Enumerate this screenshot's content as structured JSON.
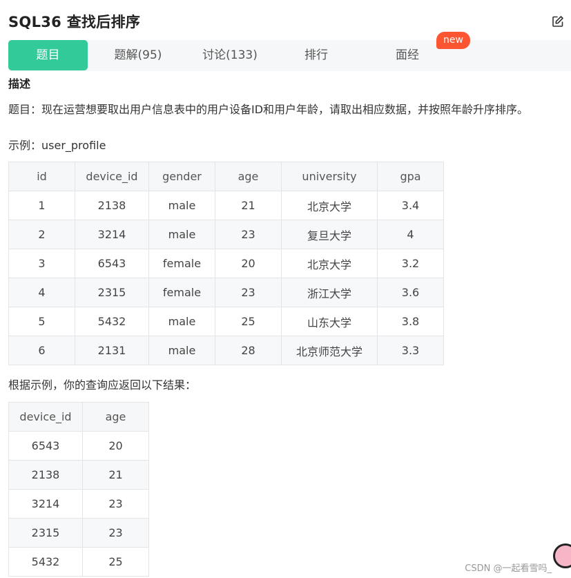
{
  "header": {
    "title": "SQL36  查找后排序"
  },
  "tabs": [
    {
      "label": "题目",
      "active": true
    },
    {
      "label": "题解(95)",
      "active": false
    },
    {
      "label": "讨论(133)",
      "active": false
    },
    {
      "label": "排行",
      "active": false
    },
    {
      "label": "面经",
      "active": false
    }
  ],
  "badge": {
    "label": "new"
  },
  "description": {
    "heading": "描述",
    "text": "题目：现在运营想要取出用户信息表中的用户设备ID和用户年龄，请取出相应数据，并按照年龄升序排序。"
  },
  "example": {
    "label": "示例：user_profile",
    "columns": [
      "id",
      "device_id",
      "gender",
      "age",
      "university",
      "gpa"
    ],
    "rows": [
      [
        "1",
        "2138",
        "male",
        "21",
        "北京大学",
        "3.4"
      ],
      [
        "2",
        "3214",
        "male",
        "23",
        "复旦大学",
        "4"
      ],
      [
        "3",
        "6543",
        "female",
        "20",
        "北京大学",
        "3.2"
      ],
      [
        "4",
        "2315",
        "female",
        "23",
        "浙江大学",
        "3.6"
      ],
      [
        "5",
        "5432",
        "male",
        "25",
        "山东大学",
        "3.8"
      ],
      [
        "6",
        "2131",
        "male",
        "28",
        "北京师范大学",
        "3.3"
      ]
    ]
  },
  "result": {
    "label": "根据示例，你的查询应返回以下结果：",
    "columns": [
      "device_id",
      "age"
    ],
    "rows": [
      [
        "6543",
        "20"
      ],
      [
        "2138",
        "21"
      ],
      [
        "3214",
        "23"
      ],
      [
        "2315",
        "23"
      ],
      [
        "5432",
        "25"
      ]
    ]
  },
  "watermark": "CSDN @一起看雪吗_",
  "colors": {
    "accent": "#32ca99",
    "badge": "#fc5531"
  },
  "icons": {
    "edit": "edit-icon"
  }
}
